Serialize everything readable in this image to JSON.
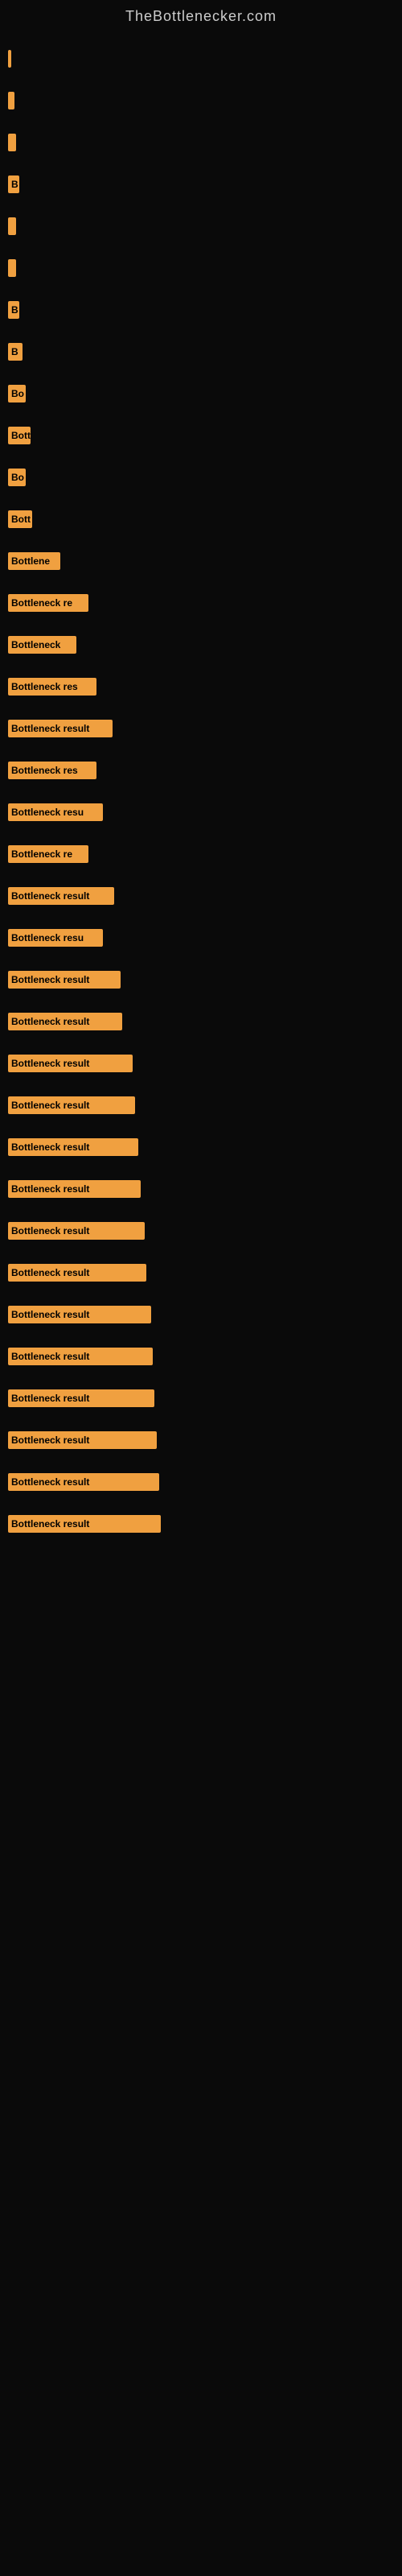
{
  "site": {
    "title": "TheBottlenecker.com"
  },
  "bars": [
    {
      "label": "",
      "width": 4,
      "text": ""
    },
    {
      "label": "",
      "width": 8,
      "text": ""
    },
    {
      "label": "",
      "width": 10,
      "text": ""
    },
    {
      "label": "B",
      "width": 14,
      "text": "B"
    },
    {
      "label": "",
      "width": 10,
      "text": ""
    },
    {
      "label": "",
      "width": 10,
      "text": ""
    },
    {
      "label": "B",
      "width": 14,
      "text": "B"
    },
    {
      "label": "B",
      "width": 18,
      "text": "B"
    },
    {
      "label": "Bo",
      "width": 22,
      "text": "Bo"
    },
    {
      "label": "Bott",
      "width": 28,
      "text": "Bott"
    },
    {
      "label": "Bo",
      "width": 22,
      "text": "Bo"
    },
    {
      "label": "Bott",
      "width": 30,
      "text": "Bott"
    },
    {
      "label": "Bottlene",
      "width": 65,
      "text": "Bottlene"
    },
    {
      "label": "Bottleneck re",
      "width": 100,
      "text": "Bottleneck re"
    },
    {
      "label": "Bottleneck",
      "width": 85,
      "text": "Bottleneck"
    },
    {
      "label": "Bottleneck res",
      "width": 110,
      "text": "Bottleneck res"
    },
    {
      "label": "Bottleneck result",
      "width": 130,
      "text": "Bottleneck result"
    },
    {
      "label": "Bottleneck res",
      "width": 110,
      "text": "Bottleneck res"
    },
    {
      "label": "Bottleneck resu",
      "width": 118,
      "text": "Bottleneck resu"
    },
    {
      "label": "Bottleneck re",
      "width": 100,
      "text": "Bottleneck re"
    },
    {
      "label": "Bottleneck result",
      "width": 132,
      "text": "Bottleneck result"
    },
    {
      "label": "Bottleneck resu",
      "width": 118,
      "text": "Bottleneck resu"
    },
    {
      "label": "Bottleneck result",
      "width": 140,
      "text": "Bottleneck result"
    },
    {
      "label": "Bottleneck result",
      "width": 142,
      "text": "Bottleneck result"
    },
    {
      "label": "Bottleneck result",
      "width": 155,
      "text": "Bottleneck result"
    },
    {
      "label": "Bottleneck result",
      "width": 158,
      "text": "Bottleneck result"
    },
    {
      "label": "Bottleneck result",
      "width": 162,
      "text": "Bottleneck result"
    },
    {
      "label": "Bottleneck result",
      "width": 165,
      "text": "Bottleneck result"
    },
    {
      "label": "Bottleneck result",
      "width": 170,
      "text": "Bottleneck result"
    },
    {
      "label": "Bottleneck result",
      "width": 172,
      "text": "Bottleneck result"
    },
    {
      "label": "Bottleneck result",
      "width": 178,
      "text": "Bottleneck result"
    },
    {
      "label": "Bottleneck result",
      "width": 180,
      "text": "Bottleneck result"
    },
    {
      "label": "Bottleneck result",
      "width": 182,
      "text": "Bottleneck result"
    },
    {
      "label": "Bottleneck result",
      "width": 185,
      "text": "Bottleneck result"
    },
    {
      "label": "Bottleneck result",
      "width": 188,
      "text": "Bottleneck result"
    },
    {
      "label": "Bottleneck result",
      "width": 190,
      "text": "Bottleneck result"
    }
  ]
}
